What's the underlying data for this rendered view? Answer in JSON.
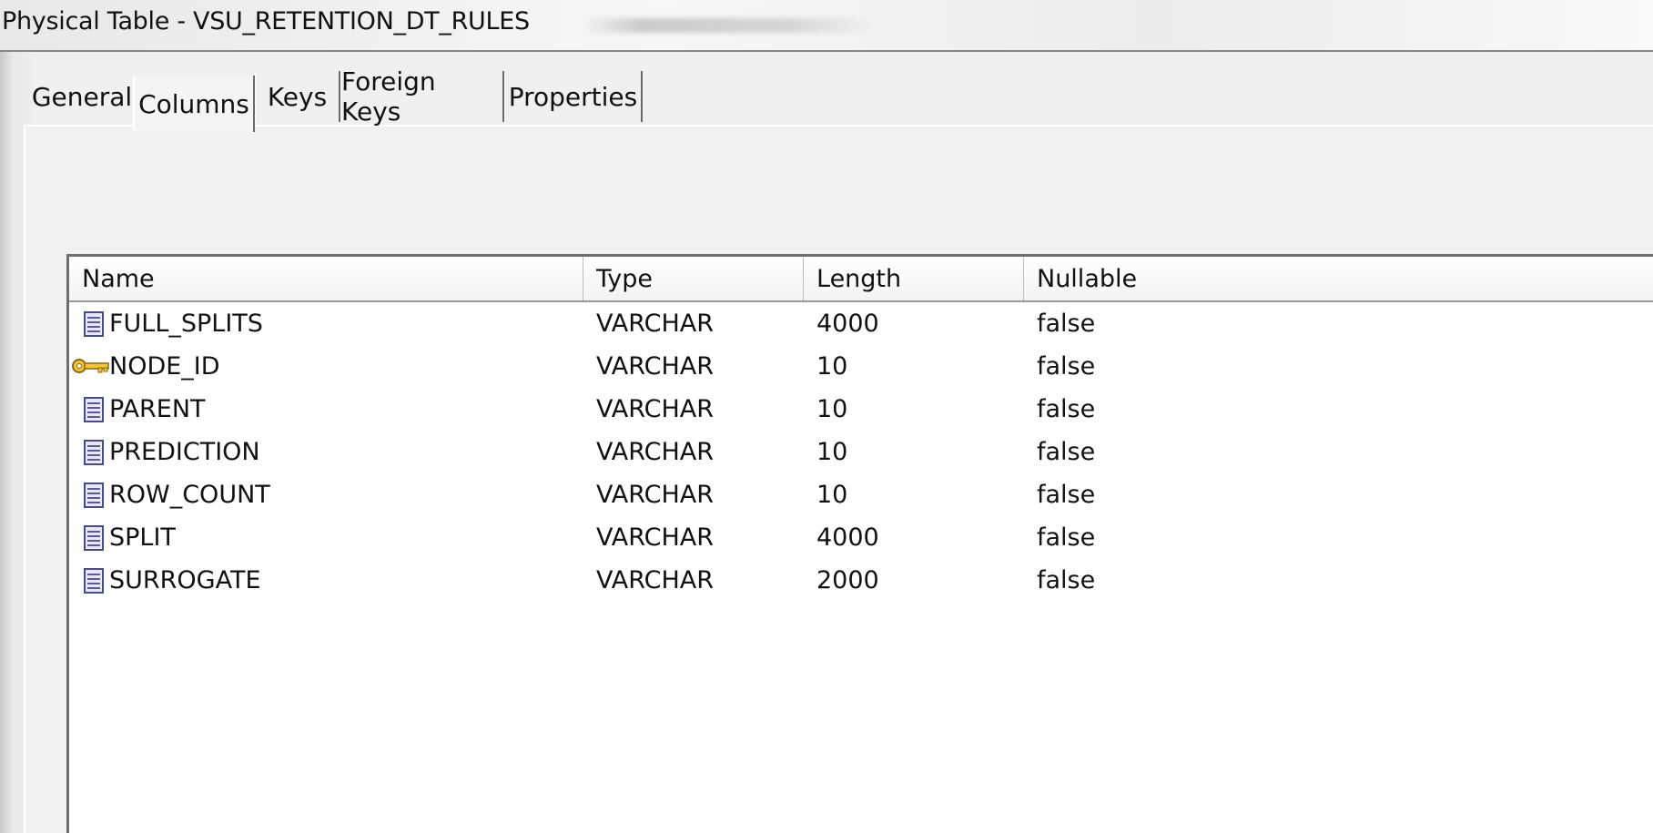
{
  "window": {
    "title": "Physical Table - VSU_RETENTION_DT_RULES"
  },
  "tabs": [
    {
      "label": "General",
      "active": false
    },
    {
      "label": "Columns",
      "active": true
    },
    {
      "label": "Keys",
      "active": false
    },
    {
      "label": "Foreign Keys",
      "active": false
    },
    {
      "label": "Properties",
      "active": false
    }
  ],
  "table": {
    "headers": [
      "Name",
      "Type",
      "Length",
      "Nullable"
    ],
    "rows": [
      {
        "icon": "column-icon",
        "name": "FULL_SPLITS",
        "type": "VARCHAR",
        "length": "4000",
        "nullable": "false"
      },
      {
        "icon": "key-icon",
        "name": "NODE_ID",
        "type": "VARCHAR",
        "length": "10",
        "nullable": "false"
      },
      {
        "icon": "column-icon",
        "name": "PARENT",
        "type": "VARCHAR",
        "length": "10",
        "nullable": "false"
      },
      {
        "icon": "column-icon",
        "name": "PREDICTION",
        "type": "VARCHAR",
        "length": "10",
        "nullable": "false"
      },
      {
        "icon": "column-icon",
        "name": "ROW_COUNT",
        "type": "VARCHAR",
        "length": "10",
        "nullable": "false"
      },
      {
        "icon": "column-icon",
        "name": "SPLIT",
        "type": "VARCHAR",
        "length": "4000",
        "nullable": "false"
      },
      {
        "icon": "column-icon",
        "name": "SURROGATE",
        "type": "VARCHAR",
        "length": "2000",
        "nullable": "false"
      }
    ]
  },
  "colors": {
    "column_icon": "#5a5aa0",
    "key_icon": "#e0b020"
  }
}
